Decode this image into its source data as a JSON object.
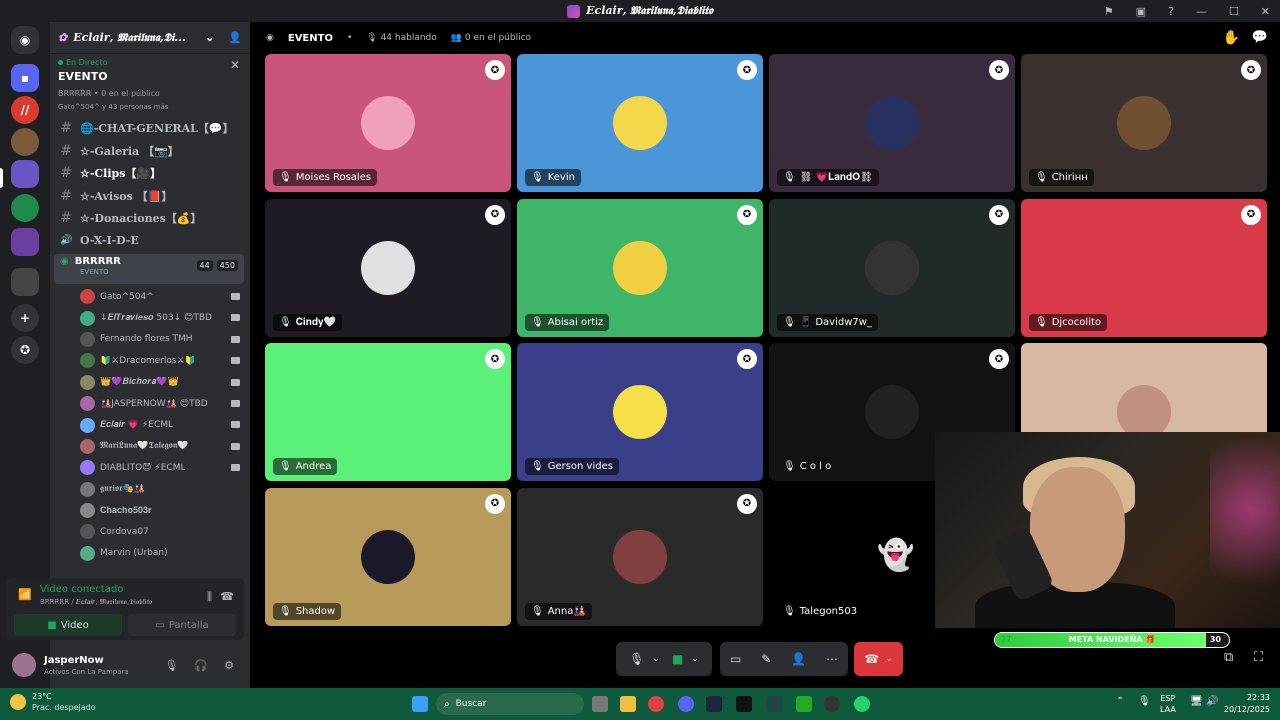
{
  "window": {
    "title": "𝑬𝒄𝒍𝒂𝒊𝒓, 𝕸𝖆𝖗𝖎𝖑𝖚𝖓𝖆,𝕯𝖎𝖆𝖇𝖑𝖎𝖙𝖔"
  },
  "server": {
    "name": "𝑬𝒄𝒍𝒂𝒊𝒓, 𝕸𝖆𝖗𝖎𝖑𝖚𝖓𝖆,𝕯𝖎..."
  },
  "live": {
    "label": "En Directo",
    "title": "EVENTO",
    "sub": "BRRRRR • 0 en el público",
    "sub2": "Gato^504^ y 43 personas más"
  },
  "channels": [
    {
      "name": "🌐-CHAT-GENERAL【💬】",
      "icon": "#"
    },
    {
      "name": "☆-Galeria 【📷】",
      "icon": "#"
    },
    {
      "name": "☆-Clips【🎥】",
      "icon": "#"
    },
    {
      "name": "☆-Avisos 【📕】",
      "icon": "#"
    },
    {
      "name": "☆-Donaciones【💰】",
      "icon": "#"
    },
    {
      "name": "O-X-I-D-E",
      "icon": "🔊"
    }
  ],
  "voice_channel": {
    "name": "BRRRRR",
    "sub": "EVENTO",
    "count1": "44",
    "count2": "450"
  },
  "users": [
    {
      "name": "Gato^504^",
      "color": "#c44"
    },
    {
      "name": "↓𝑬𝒍𝑻𝒓𝒂𝒗𝒊𝒆𝒔𝒐 503↓ 😊TBD",
      "color": "#4a8"
    },
    {
      "name": "Fernando flores TMH",
      "color": "#555"
    },
    {
      "name": "🔰⚔Dracomerlos⚔🔰",
      "color": "#474"
    },
    {
      "name": "👑💜𝑩𝒊𝒄𝒉𝒐𝒓𝒂💜👑",
      "color": "#886"
    },
    {
      "name": "🎎JASPERNOW🎎 😊TBD",
      "color": "#a6a"
    },
    {
      "name": "𝑬𝒄𝒍𝒂𝒊𝒓 💗 ⚡ECML",
      "color": "#6af"
    },
    {
      "name": "𝕸𝖆𝖗𝖎𝕷𝖚𝖓𝖆🤍𝕿𝖆𝖑𝖊𝖌𝖔𝖓🤍",
      "color": "#a66"
    },
    {
      "name": "DIABLITO😈 ⚡ECML",
      "color": "#97f"
    },
    {
      "name": "𝖌𝖚𝖗𝖎𝖔𝖗🎭🎎",
      "color": "#777"
    },
    {
      "name": "𝐂𝐡𝐚𝐜𝐡𝐨𝟓𝟎𝟑𝐫",
      "color": "#888"
    },
    {
      "name": "Cordova07",
      "color": "#555"
    },
    {
      "name": "Marvin (Urban)",
      "color": "#5a8"
    }
  ],
  "voice_panel": {
    "status": "Video conectado",
    "sub": "BRRRRR / 𝑬𝒄𝒍𝒂𝒊𝒓, 𝕸𝖆𝖗𝖎𝖑𝖚𝖓𝖆,𝕯𝖎𝖆𝖇𝖑𝖎𝖙𝖔",
    "video": "Video",
    "screen": "Pantalla"
  },
  "user_panel": {
    "name": "JasperNow",
    "status": "Activos Con La Pampara"
  },
  "stage_header": {
    "title": "EVENTO",
    "speakers": "44 hablando",
    "audience": "0 en el público"
  },
  "tiles": [
    {
      "name": "Moises Rosales",
      "bg": "#c9567a",
      "av": "#f0a0b8"
    },
    {
      "name": "Kevin",
      "bg": "#4a96d9",
      "av": "#f5d74a"
    },
    {
      "name": "⛓ 💗𝐋𝐚𝐧𝐝𝐎⛓",
      "bg": "#3a2a3d",
      "av": "#283060"
    },
    {
      "name": "Chiriнн",
      "bg": "#3a3030",
      "av": "#705030"
    },
    {
      "name": "𝐂𝐢𝐧𝐝𝐲🤍",
      "bg": "#1e1b24",
      "av": "#e0e0e0"
    },
    {
      "name": "Abisai ortiz",
      "bg": "#3fb56a",
      "av": "#f0d040"
    },
    {
      "name": "📱 Davidw7w_",
      "bg": "#202a28",
      "av": "#333"
    },
    {
      "name": "Djcocolito",
      "bg": "#d93a4a",
      "av": "#d93a4a"
    },
    {
      "name": "Andrea",
      "bg": "#5af07a",
      "av": "#5af07a"
    },
    {
      "name": "Gerson vides",
      "bg": "#3a3f8a",
      "av": "#f5e04a"
    },
    {
      "name": "C o l o",
      "bg": "#121212",
      "av": "#222"
    },
    {
      "name": "",
      "bg": "#d8b8a0",
      "av": "#c09080"
    },
    {
      "name": "Shadow",
      "bg": "#b89a5a",
      "av": "#1a1a2a"
    },
    {
      "name": "Anna🎎",
      "bg": "#2a2a2a",
      "av": "#804040"
    },
    {
      "name": "Talegon503",
      "bg": "#000000",
      "av": "#000000"
    }
  ],
  "goal": {
    "left": "27",
    "label": "META NAVIDEÑA 🎁",
    "right": "30",
    "progress": 0.9
  },
  "taskbar": {
    "temp": "23°C",
    "weather": "Prac. despejado",
    "search": "Buscar",
    "lang1": "ESP",
    "lang2": "LAA",
    "time": "22:33",
    "date": "20/12/2025"
  },
  "servers": [
    {
      "color": "#5865f2"
    },
    {
      "color": "#d83b2e"
    },
    {
      "color": "#7a5a3a"
    },
    {
      "color": "#6a55c5"
    },
    {
      "color": "#1f8a4a"
    },
    {
      "color": "#6b3fa0"
    },
    {
      "color": "#444"
    }
  ]
}
